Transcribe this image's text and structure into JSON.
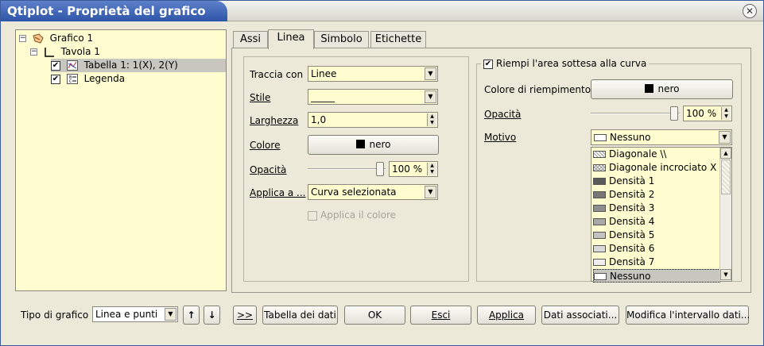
{
  "window": {
    "title": "Qtiplot - Proprietà del grafico"
  },
  "tree": {
    "items": [
      {
        "label": "Grafico 1",
        "expander": "−"
      },
      {
        "label": "Tavola 1",
        "expander": "−"
      },
      {
        "label": "Tabella 1: 1(X), 2(Y)",
        "checked": true,
        "selected": true
      },
      {
        "label": "Legenda",
        "checked": true
      }
    ]
  },
  "tabs": [
    "Assi",
    "Linea",
    "Simbolo",
    "Etichette"
  ],
  "active_tab": "Linea",
  "line": {
    "traccia_label": "Traccia con",
    "traccia_value": "Linee",
    "stile_label": "Stile",
    "stile_value": "_____",
    "larghezza_label": "Larghezza",
    "larghezza_value": "1,0",
    "colore_label": "Colore",
    "colore_value": "nero",
    "opacita_label": "Opacità",
    "opacita_value": "100 %",
    "opacita_level": 1.0,
    "applica_label": "Applica a ...",
    "applica_value": "Curva selezionata",
    "applica_colore_label": "Applica il colore"
  },
  "fill": {
    "group_label": "Riempi l'area sottesa alla curva",
    "group_checked": true,
    "colore_label": "Colore di riempimento",
    "colore_value": "nero",
    "opacita_label": "Opacità",
    "opacita_value": "100 %",
    "opacita_level": 1.0,
    "motivo_label": "Motivo",
    "motivo_value": "Nessuno",
    "motivo_options": [
      "Diagonale \\\\",
      "Diagonale incrociato X",
      "Densità 1",
      "Densità 2",
      "Densità 3",
      "Densità 4",
      "Densità 5",
      "Densità 6",
      "Densità 7",
      "Nessuno"
    ]
  },
  "bottom": {
    "tipo_label": "Tipo di grafico",
    "tipo_value": "Linea e punti",
    "up_arrow": "↑",
    "down_arrow": "↓",
    "expand_label": ">>",
    "tabella_label": "Tabella dei dati",
    "ok_label": "OK",
    "esci_label": "Esci",
    "applica_label": "Applica",
    "dati_label": "Dati associati...",
    "modifica_label": "Modifica l'intervallo dati..."
  },
  "colors": {
    "title_bg": "#2e55a8",
    "field_bg": "#fffdd0",
    "dialog_bg": "#ece9d8"
  }
}
